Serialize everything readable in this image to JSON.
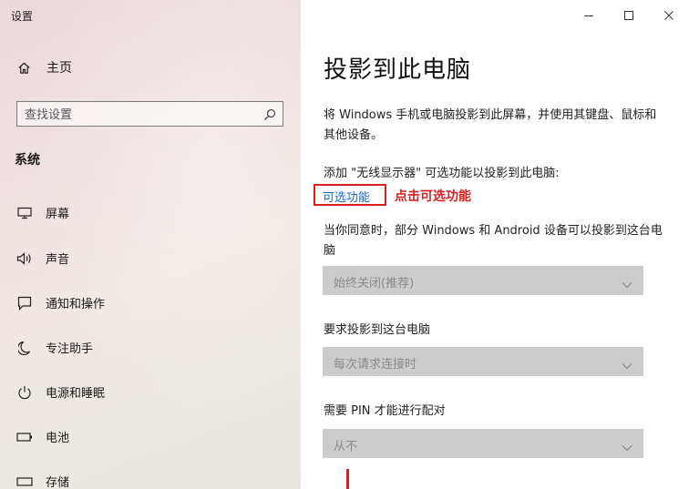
{
  "app": {
    "title": "设置"
  },
  "sidebar": {
    "home_label": "主页",
    "search_placeholder": "查找设置",
    "section_title": "系统",
    "items": [
      {
        "label": "屏幕",
        "icon": "monitor-icon"
      },
      {
        "label": "声音",
        "icon": "speaker-icon"
      },
      {
        "label": "通知和操作",
        "icon": "notification-icon"
      },
      {
        "label": "专注助手",
        "icon": "moon-icon"
      },
      {
        "label": "电源和睡眠",
        "icon": "power-icon"
      },
      {
        "label": "电池",
        "icon": "battery-icon"
      },
      {
        "label": "存储",
        "icon": "storage-icon"
      }
    ]
  },
  "window_controls": {
    "minimize": "minimize-icon",
    "maximize": "maximize-icon",
    "close": "close-icon"
  },
  "main": {
    "title": "投影到此电脑",
    "description": "将 Windows 手机或电脑投影到此屏幕，并使用其键盘、鼠标和其他设备。",
    "add_text": "添加 \"无线显示器\" 可选功能以投影到此电脑:",
    "optional_link": "可选功能",
    "annotation": "点击可选功能",
    "fields": [
      {
        "label": "当你同意时，部分 Windows 和 Android 设备可以投影到这台电脑",
        "value": "始终关闭(推荐)"
      },
      {
        "label": "要求投影到这台电脑",
        "value": "每次请求连接时"
      },
      {
        "label": "需要 PIN 才能进行配对",
        "value": "从不"
      }
    ]
  },
  "colors": {
    "link": "#1b6ac9",
    "annotation_red": "#d92020",
    "disabled_select": "#cccccc"
  }
}
